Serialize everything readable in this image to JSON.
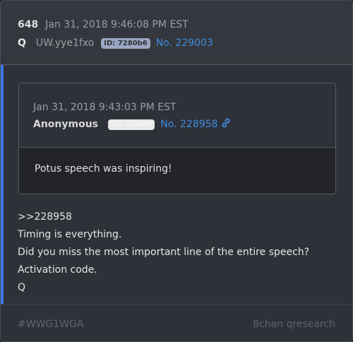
{
  "post": {
    "number": "648",
    "date": "Jan 31, 2018 9:46:08 PM EST",
    "author": "Q",
    "tripcode": "UW.yye1fxo",
    "id_badge": "ID: 7280b6",
    "post_link": "No. 229003"
  },
  "quote": {
    "date": "Jan 31, 2018 9:43:03 PM EST",
    "author": "Anonymous",
    "id_badge": "ID: e3e8f0",
    "post_link": "No. 228958",
    "text": "Potus speech was inspiring!"
  },
  "content_lines": [
    ">>228958",
    "Timing is everything.",
    "Did you miss the most important line of the entire speech?",
    "Activation code.",
    "Q"
  ],
  "footer": {
    "tag": "#WWG1WGA",
    "source": "8chan qresearch"
  },
  "colors": {
    "accent": "#3b78e7",
    "link": "#3e8ede",
    "id_badge": "#9ba7c2"
  }
}
